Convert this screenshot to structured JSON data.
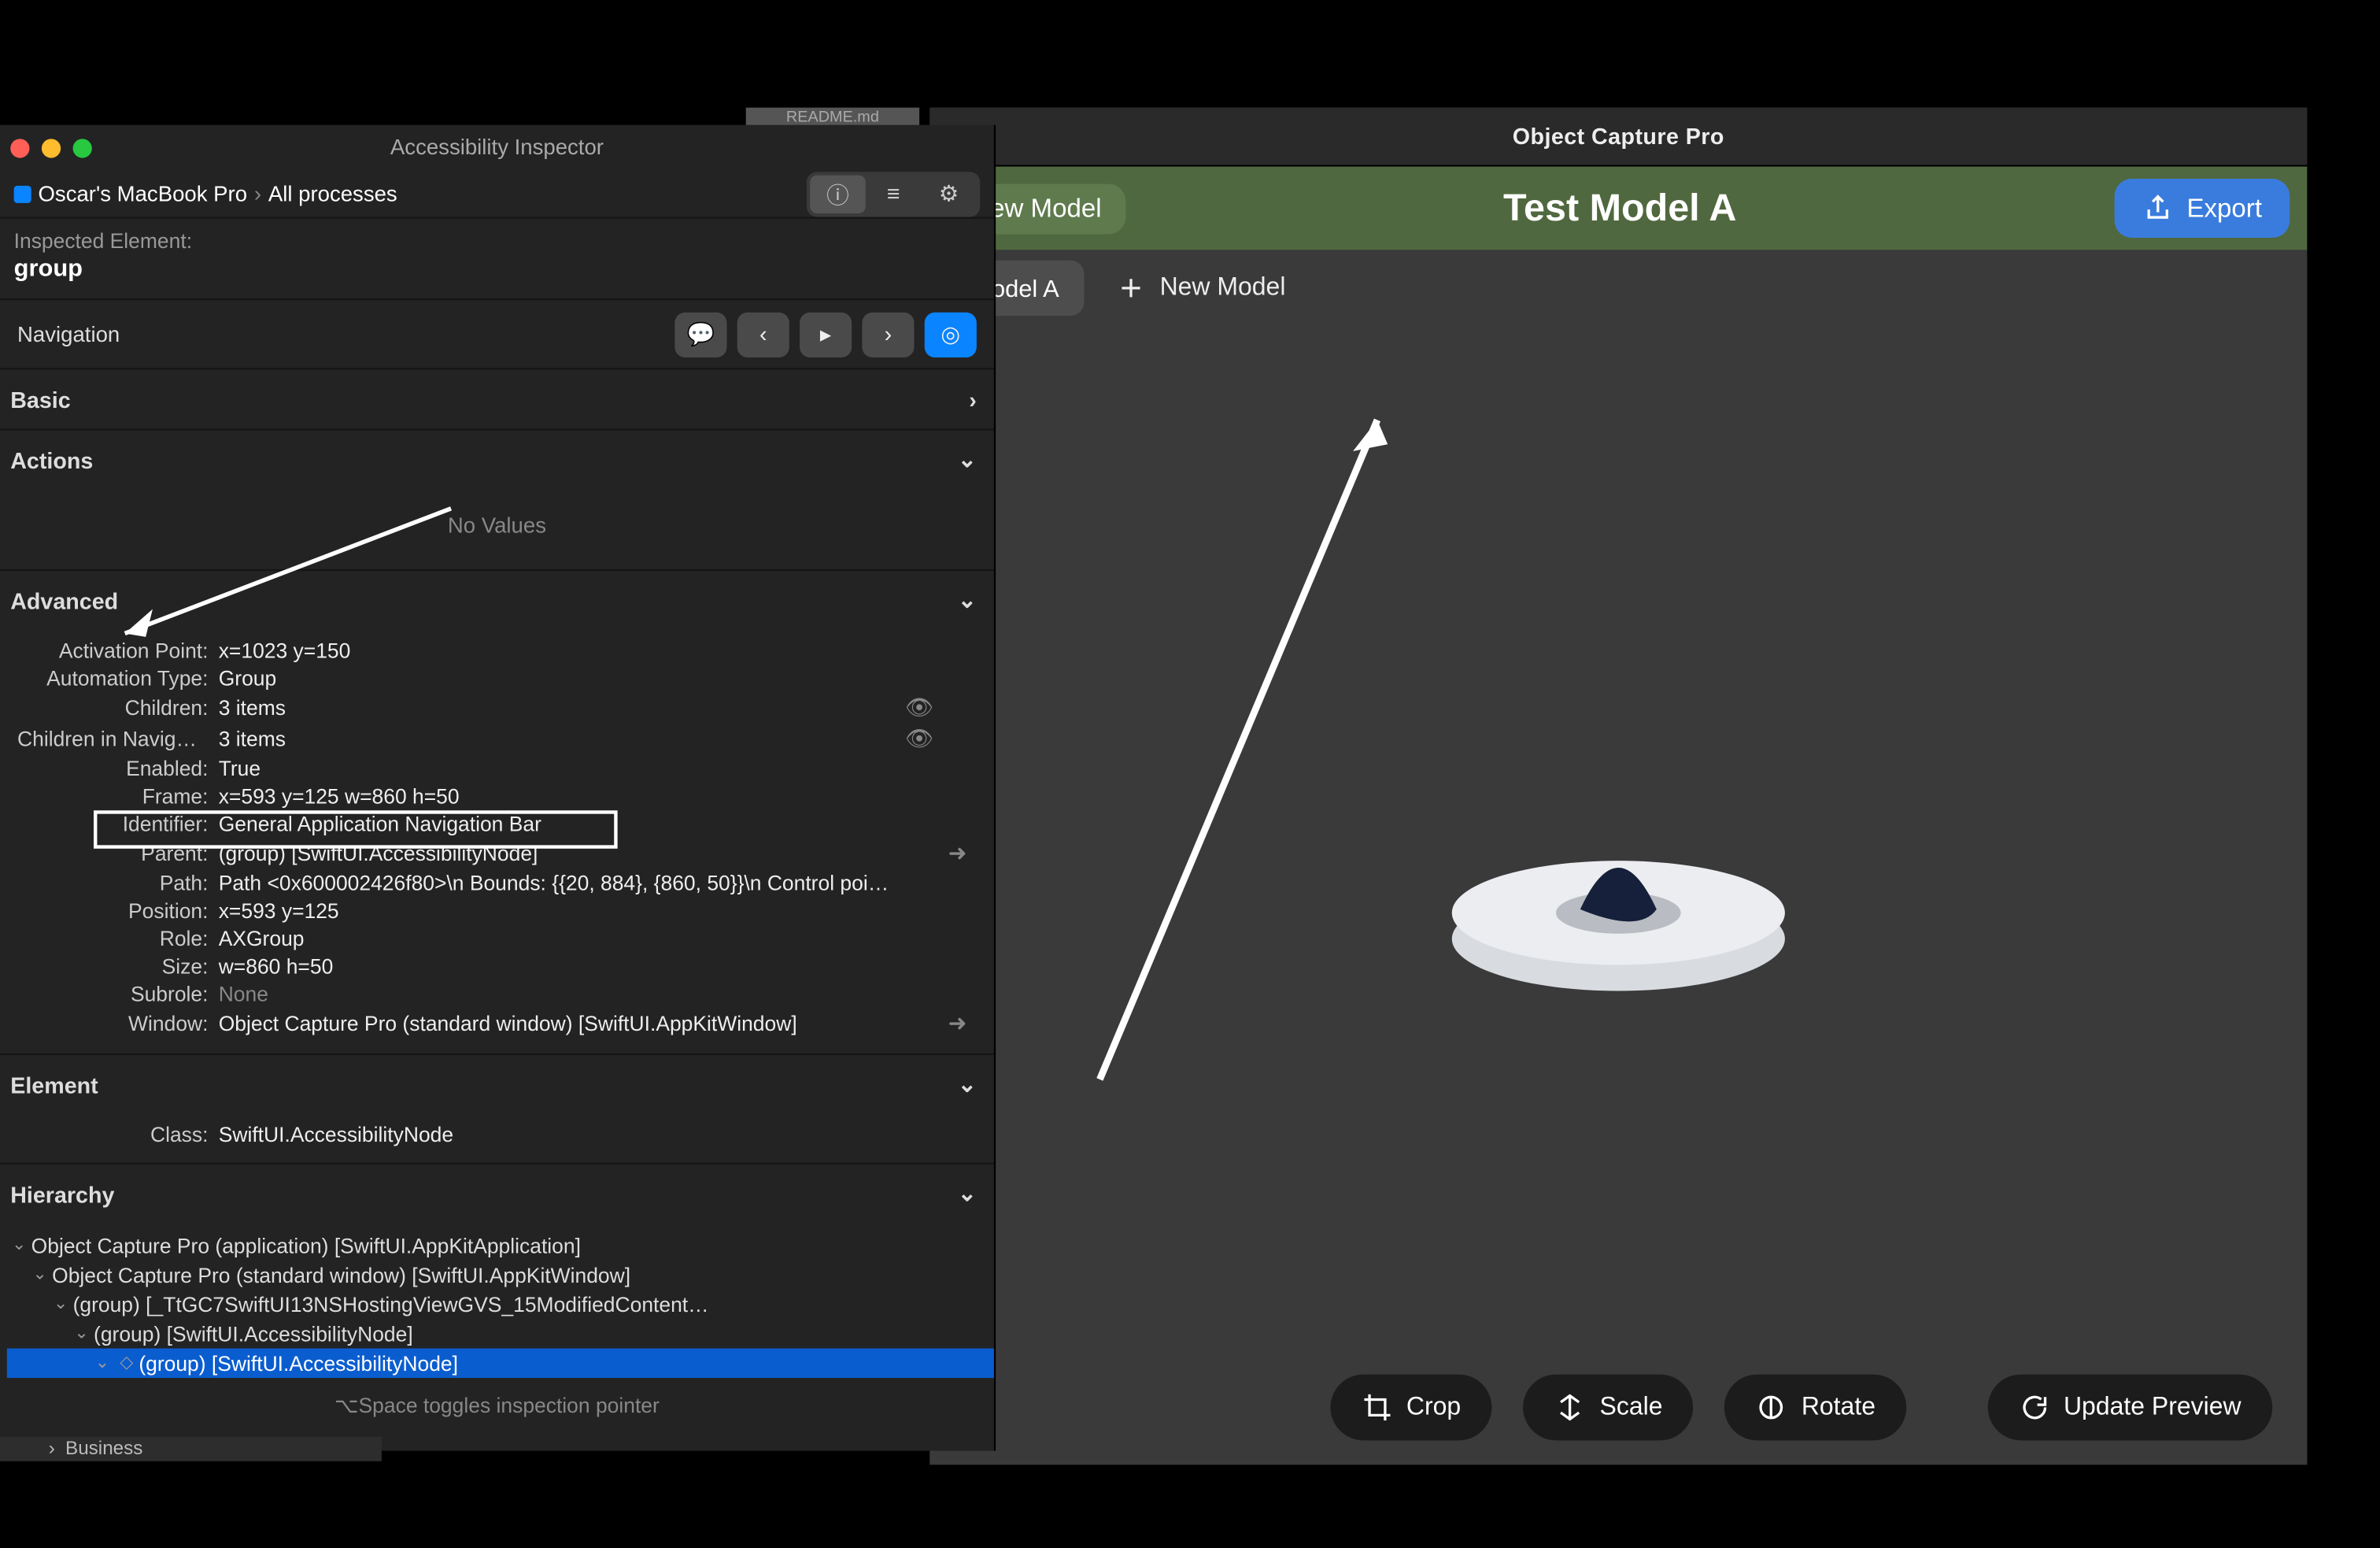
{
  "inspector": {
    "title": "Accessibility Inspector",
    "breadcrumb_host": "Oscar's MacBook Pro",
    "breadcrumb_target": "All processes",
    "inspected_label": "Inspected Element:",
    "inspected_value": "group",
    "nav_label": "Navigation",
    "sections": {
      "basic": "Basic",
      "actions": "Actions",
      "advanced": "Advanced",
      "element": "Element",
      "hierarchy": "Hierarchy"
    },
    "no_values": "No Values",
    "advanced_rows": {
      "Activation Point": "x=1023 y=150",
      "Automation Type": "Group",
      "Children": "3 items",
      "Children in Navigati…": "3 items",
      "Enabled": "True",
      "Frame": "x=593 y=125 w=860 h=50",
      "Identifier": "General Application Navigation Bar",
      "Parent": "<empty description> (group) [SwiftUI.AccessibilityNode]",
      "Path": "Path <0x600002426f80>\\n  Bounds: {{20, 884}, {860, 50}}\\n  Control poi…",
      "Position": "x=593 y=125",
      "Role": "AXGroup",
      "Size": "w=860 h=50",
      "Subrole": "None",
      "Window": "Object Capture Pro (standard window) [SwiftUI.AppKitWindow]"
    },
    "element_rows": {
      "Class": "SwiftUI.AccessibilityNode"
    },
    "hierarchy": [
      "Object Capture Pro (application) [SwiftUI.AppKitApplication]",
      "Object Capture Pro (standard window) [SwiftUI.AppKitWindow]",
      "<empty description> (group) [_TtGC7SwiftUI13NSHostingViewGVS_15ModifiedContent…",
      "<empty description> (group) [SwiftUI.AccessibilityNode]",
      "<empty description> (group) [SwiftUI.AccessibilityNode]"
    ],
    "footer": "⌥Space toggles inspection pointer"
  },
  "bottom_strip": "Business",
  "tab_ghost": "README.md",
  "app": {
    "window_title": "Object Capture Pro",
    "nav_left": "New Model",
    "nav_title": "Test Model A",
    "export": "Export",
    "tabs": {
      "current": "Model A",
      "new": "New Model"
    },
    "tools": {
      "crop": "Crop",
      "scale": "Scale",
      "rotate": "Rotate",
      "update": "Update Preview"
    }
  }
}
